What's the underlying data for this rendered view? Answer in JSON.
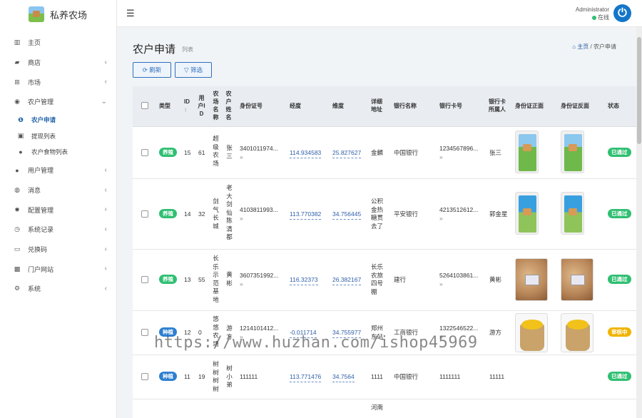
{
  "app": {
    "title": "私养农场",
    "user_name": "Administrator",
    "user_status": "在线"
  },
  "sidebar": {
    "items": [
      {
        "label": "主页",
        "icon": "bar-chart-icon",
        "chev": false
      },
      {
        "label": "商店",
        "icon": "shopping-bag-icon",
        "chev": true
      },
      {
        "label": "市场",
        "icon": "cart-icon",
        "chev": true
      },
      {
        "label": "农户管理",
        "icon": "compass-icon",
        "chev": true,
        "open": true
      },
      {
        "label": "用户管理",
        "icon": "user-icon",
        "chev": true
      },
      {
        "label": "消息",
        "icon": "chat-icon",
        "chev": true
      },
      {
        "label": "配置管理",
        "icon": "gear-icon",
        "chev": true
      },
      {
        "label": "系统记录",
        "icon": "clock-icon",
        "chev": true
      },
      {
        "label": "兑换码",
        "icon": "card-icon",
        "chev": true
      },
      {
        "label": "门户网站",
        "icon": "image-icon",
        "chev": true
      },
      {
        "label": "系统",
        "icon": "gear-icon",
        "chev": true
      }
    ],
    "sub_items": [
      {
        "label": "农户申请",
        "icon": "info-icon",
        "active": true
      },
      {
        "label": "提现列表",
        "icon": "money-icon",
        "active": false
      },
      {
        "label": "农户食物列表",
        "icon": "apple-icon",
        "active": false
      }
    ]
  },
  "page": {
    "title": "农户申请",
    "subtitle": "列表",
    "breadcrumb_home": "主页",
    "breadcrumb_sep": "/",
    "breadcrumb_current": "农户申请",
    "refresh_label": "刷新",
    "filter_label": "筛选"
  },
  "table": {
    "headers": {
      "type": "类型",
      "id": "ID",
      "user_id": "用户ID",
      "farm_name": "农场名称",
      "farmer_name": "农户姓名",
      "id_number": "身份证号",
      "longitude": "经度",
      "latitude": "维度",
      "address": "详细地址",
      "bank_name": "银行名称",
      "bank_card": "银行卡号",
      "card_holder": "银行卡所属人",
      "id_front": "身份证正面",
      "id_back": "身份证反面",
      "status": "状态"
    },
    "rows": [
      {
        "type": "养殖",
        "id": "15",
        "user_id": "61",
        "farm_name": "超级农场",
        "farmer_name": "张三",
        "id_number": "3401011974...",
        "longitude": "114.934583",
        "latitude": "25.827627",
        "address": "金麟",
        "bank_name": "中国银行",
        "bank_card": "1234567896...",
        "card_holder": "张三",
        "status": "已通过"
      },
      {
        "type": "养殖",
        "id": "14",
        "user_id": "32",
        "farm_name": "剑气长城",
        "farmer_name": "老大剑仙陈清都",
        "id_number": "4103811993...",
        "longitude": "113.770382",
        "latitude": "34.756445",
        "address": "公积金热糖贯去了",
        "bank_name": "平安银行",
        "bank_card": "4213512612...",
        "card_holder": "郭金星",
        "status": "已通过"
      },
      {
        "type": "养殖",
        "id": "13",
        "user_id": "55",
        "farm_name": "长乐示范基地",
        "farmer_name": "黄彬",
        "id_number": "3607351992...",
        "longitude": "116.32373",
        "latitude": "26.382167",
        "address": "长乐农旅四号棚",
        "bank_name": "建行",
        "bank_card": "5264103861...",
        "card_holder": "黄彬",
        "status": "已通过"
      },
      {
        "type": "种植",
        "id": "12",
        "user_id": "0",
        "farm_name": "悠悠农场",
        "farmer_name": "游方",
        "id_number": "1214101412...",
        "longitude": "-0.011714",
        "latitude": "34.755977",
        "address": "郑州东站",
        "bank_name": "工商银行",
        "bank_card": "1322546522...",
        "card_holder": "游方",
        "status": "审核中"
      },
      {
        "type": "种植",
        "id": "11",
        "user_id": "19",
        "farm_name": "树树树树",
        "farmer_name": "树小弟",
        "id_number": "111111",
        "longitude": "113.771476",
        "latitude": "34.7564",
        "address": "1111",
        "bank_name": "中国银行",
        "bank_card": "1111111",
        "card_holder": "11111",
        "status": "已通过"
      },
      {
        "address": "河南"
      }
    ]
  },
  "watermark": "https://www.huzhan.com/ishop45969",
  "colors": {
    "primary": "#1476c9",
    "success": "#2fbf71",
    "warning": "#f0b400",
    "info": "#2d7fd0"
  }
}
